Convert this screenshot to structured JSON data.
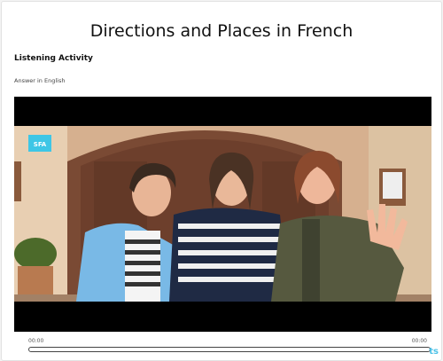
{
  "page": {
    "title": "Directions and Places in French",
    "subtitle": "Listening Activity",
    "instruction": "Answer in English"
  },
  "video": {
    "logo_text": "SFA",
    "current_time": "00:00",
    "total_time": "00:00",
    "progress": 0
  },
  "footer": {
    "peek_text": "ts"
  },
  "colors": {
    "accent": "#4fc3e8",
    "logo_bg": "#3ec6e6"
  }
}
